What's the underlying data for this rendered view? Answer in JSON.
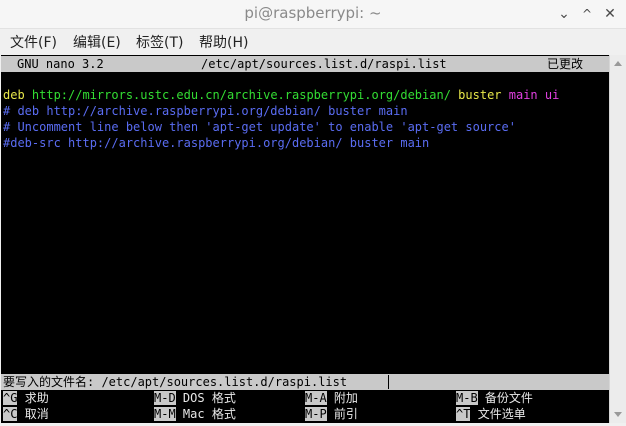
{
  "window": {
    "title": "pi@raspberrypi: ~",
    "controls": {
      "minimize": "⌄",
      "maximize": "^",
      "close": "✕"
    }
  },
  "menubar": {
    "items": [
      "文件(F)",
      "编辑(E)",
      "标签(T)",
      "帮助(H)"
    ]
  },
  "nano": {
    "version": "GNU nano 3.2",
    "filename": "/etc/apt/sources.list.d/raspi.list",
    "status": "已更改",
    "lines": [
      {
        "segments": [
          {
            "text": "deb ",
            "color": "#e8e84a"
          },
          {
            "text": "http://mirrors.ustc.edu.cn/archive.raspberrypi.org/debian/ ",
            "color": "#33dd33"
          },
          {
            "text": "buster ",
            "color": "#e8e84a"
          },
          {
            "text": "main ui",
            "color": "#e040e0"
          }
        ]
      },
      {
        "segments": [
          {
            "text": "# deb http://archive.raspberrypi.org/debian/ buster main",
            "color": "#5a6cf2"
          }
        ]
      },
      {
        "segments": [
          {
            "text": "# Uncomment line below then 'apt-get update' to enable 'apt-get source'",
            "color": "#5a6cf2"
          }
        ]
      },
      {
        "segments": [
          {
            "text": "#deb-src http://archive.raspberrypi.org/debian/ buster main",
            "color": "#5a6cf2"
          }
        ]
      }
    ],
    "prompt": {
      "label": "要写入的文件名: /etc/apt/sources.list.d/raspi.list"
    },
    "shortcuts": [
      {
        "key": "^G",
        "desc": "求助"
      },
      {
        "key": "M-D",
        "desc": "DOS 格式"
      },
      {
        "key": "M-A",
        "desc": "附加"
      },
      {
        "key": "M-B",
        "desc": "备份文件"
      },
      {
        "key": "^C",
        "desc": "取消"
      },
      {
        "key": "M-M",
        "desc": "Mac 格式"
      },
      {
        "key": "M-P",
        "desc": "前引"
      },
      {
        "key": "^T",
        "desc": "文件选单"
      }
    ]
  }
}
